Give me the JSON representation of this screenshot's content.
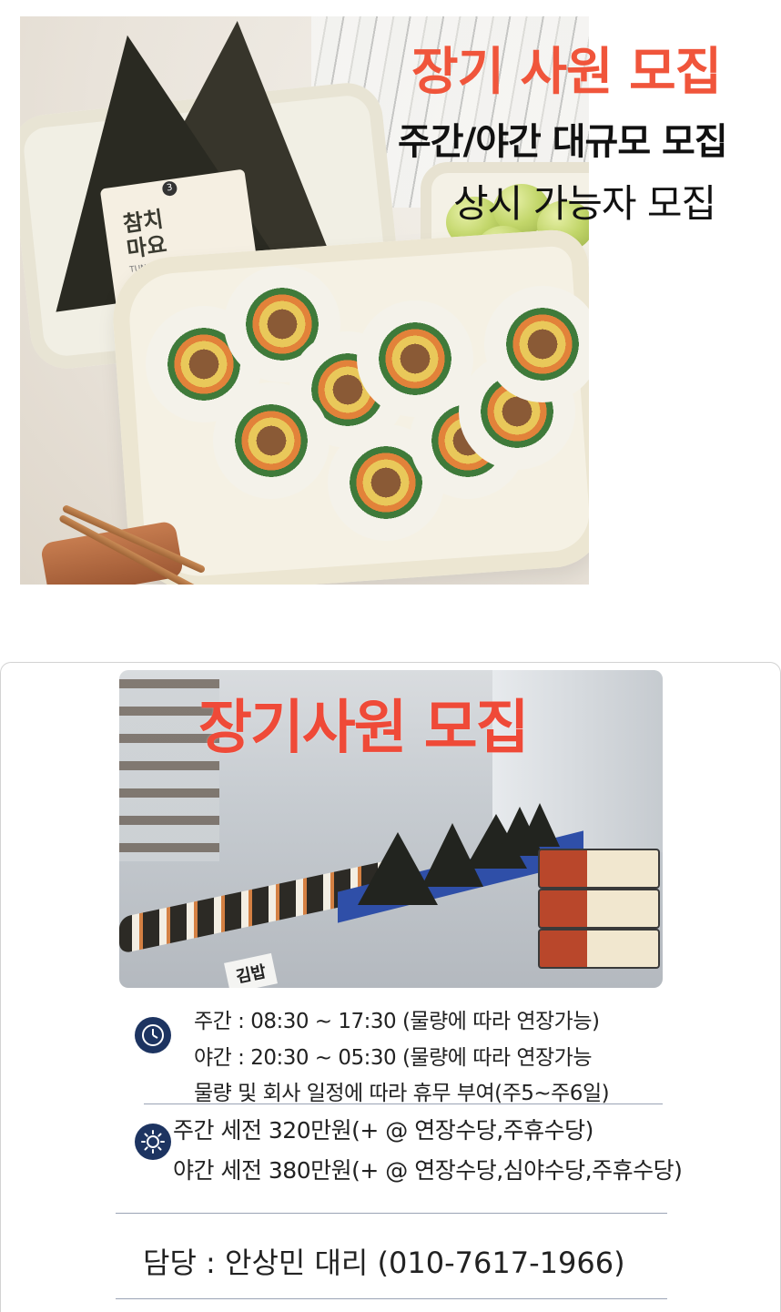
{
  "banner": {
    "title": "장기 사원 모집",
    "subtitle_1": "주간/야간 대규모 모집",
    "subtitle_2": "상시 가능자 모집",
    "product_label": "참치\n마요",
    "product_label_sub": "TUNA MAYO",
    "product_number": "3",
    "title_color": "#f0553b"
  },
  "factory": {
    "title": "장기사원 모집",
    "belt_tag": "김밥",
    "title_color": "#ef4a38"
  },
  "schedule": {
    "icon": "clock-icon",
    "day": "주간 : 08:30 ~ 17:30  (물량에 따라 연장가능)",
    "night": "야간 : 20:30 ~ 05:30 (물량에 따라 연장가능",
    "holiday": "물량 및 회사 일정에 따라 휴무 부여(주5~주6일)"
  },
  "pay": {
    "icon": "sun-icon",
    "day": "주간 세전 320만원(+ @ 연장수당,주휴수당)",
    "night": "야간 세전 380만원(+ @ 연장수당,심야수당,주휴수당)"
  },
  "contact": {
    "text": "담당 : 안상민 대리 (010-7617-1966)"
  },
  "colors": {
    "icon_bg": "#1d3461",
    "divider": "#9aa3b5"
  }
}
